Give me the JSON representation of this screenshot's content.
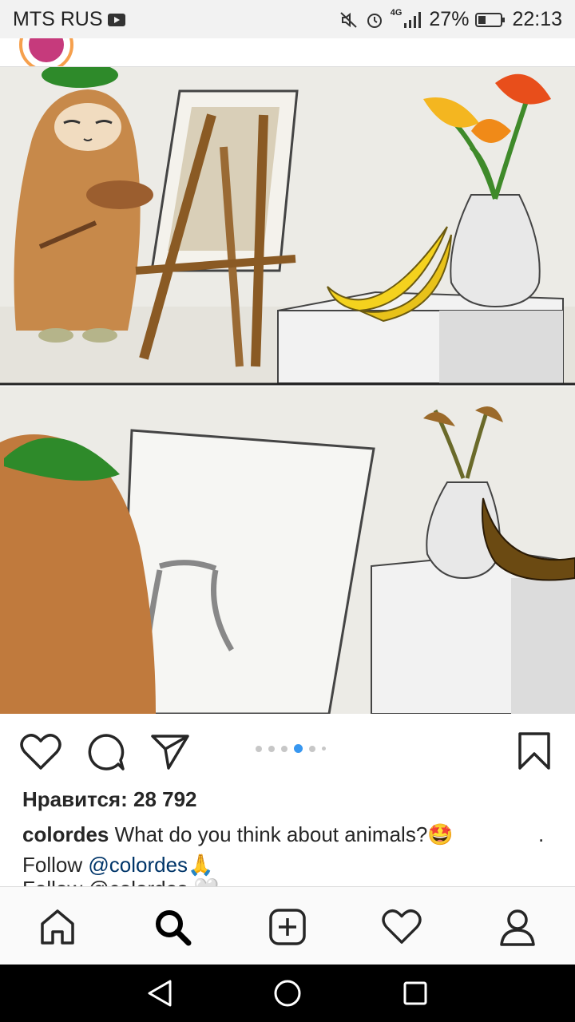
{
  "status_bar": {
    "carrier": "MTS RUS",
    "network": "4G",
    "battery": "27%",
    "time": "22:13"
  },
  "post": {
    "likes_text": "Нравится: 28 792",
    "username": "colordes",
    "caption_text": " What do you think about animals?",
    "caption_emoji": "🤩",
    "trailing_dot": ".",
    "follow_label": "Follow ",
    "follow_handle": "@colordes",
    "follow_emoji": "🙏",
    "cut_line": "Follow @colordes 🤍"
  },
  "carousel": {
    "count": 6,
    "active_index": 3
  },
  "colors": {
    "accent": "#3897f0",
    "link": "#003569",
    "text": "#262626"
  }
}
